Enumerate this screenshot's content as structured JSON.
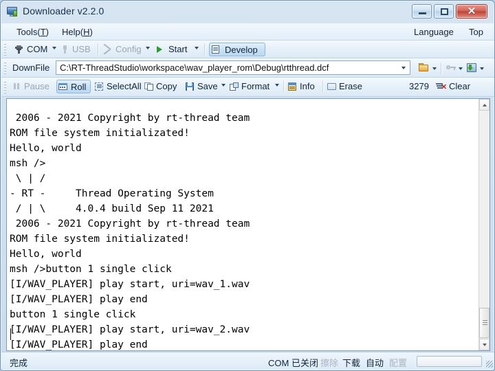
{
  "window": {
    "title": "Downloader v2.2.0",
    "icon": "monitor-download-icon",
    "controls": {
      "minimize": "minimize-icon",
      "maximize": "maximize-icon",
      "close": "✕"
    }
  },
  "menubar": {
    "items": [
      {
        "label": "Tools(T)",
        "text": "Tools(",
        "accel": "T",
        "tail": ")"
      },
      {
        "label": "Help(H)",
        "text": "Help(",
        "accel": "H",
        "tail": ")"
      }
    ],
    "right": [
      {
        "label": "Language"
      },
      {
        "label": "Top"
      }
    ]
  },
  "toolbar_main": {
    "com_label": "COM",
    "usb_label": "USB",
    "config_label": "Config",
    "start_label": "Start",
    "develop_label": "Develop"
  },
  "downfile": {
    "label": "DownFile",
    "path": "C:\\RT-ThreadStudio\\workspace\\wav_player_rom\\Debug\\rtthread.dcf",
    "open_icon": "folder-open-icon",
    "key_icon": "key-icon",
    "download_icon": "download-arrow-icon"
  },
  "toolbar_log": {
    "pause_label": "Pause",
    "roll_label": "Roll",
    "selectall_label": "SelectAll",
    "copy_label": "Copy",
    "save_label": "Save",
    "format_label": "Format",
    "info_label": "Info",
    "erase_label": "Erase",
    "byte_count": "3279",
    "clear_label": "Clear"
  },
  "terminal": {
    "lines": [
      " 2006 - 2021 Copyright by rt-thread team",
      "ROM file system initializated!",
      "Hello, world",
      "msh />",
      " \\ | /",
      "- RT -     Thread Operating System",
      " / | \\     4.0.4 build Sep 11 2021",
      " 2006 - 2021 Copyright by rt-thread team",
      "ROM file system initializated!",
      "Hello, world",
      "msh />button 1 single click",
      "[I/WAV_PLAYER] play start, uri=wav_1.wav",
      "[I/WAV_PLAYER] play end",
      "button 1 single click",
      "[I/WAV_PLAYER] play start, uri=wav_2.wav",
      "[I/WAV_PLAYER] play end"
    ]
  },
  "statusbar": {
    "state": "完成",
    "com_state": "COM 已关闭",
    "erase": "擦除",
    "download": "下载",
    "auto": "自动",
    "config": "配置"
  }
}
